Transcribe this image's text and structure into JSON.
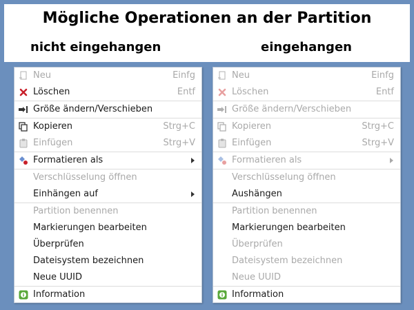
{
  "title": "Mögliche Operationen an der Partition",
  "subtitles": {
    "left": "nicht eingehangen",
    "right": "eingehangen"
  },
  "menus": [
    {
      "items": [
        {
          "label": "Neu",
          "shortcut": "Einfg",
          "enabled": false,
          "icon": "new-partition-icon"
        },
        {
          "label": "Löschen",
          "shortcut": "Entf",
          "enabled": true,
          "icon": "delete-icon"
        },
        {
          "label": "Größe ändern/Verschieben",
          "shortcut": "",
          "enabled": true,
          "icon": "resize-move-icon"
        },
        {
          "label": "Kopieren",
          "shortcut": "Strg+C",
          "enabled": true,
          "icon": "copy-icon"
        },
        {
          "label": "Einfügen",
          "shortcut": "Strg+V",
          "enabled": false,
          "icon": "paste-icon"
        },
        {
          "label": "Formatieren als",
          "shortcut": "",
          "enabled": true,
          "icon": "format-icon",
          "submenu": true
        },
        {
          "label": "Verschlüsselung öffnen",
          "shortcut": "",
          "enabled": false
        },
        {
          "label": "Einhängen auf",
          "shortcut": "",
          "enabled": true,
          "submenu": true
        },
        {
          "label": "Partition benennen",
          "shortcut": "",
          "enabled": false
        },
        {
          "label": "Markierungen bearbeiten",
          "shortcut": "",
          "enabled": true
        },
        {
          "label": "Überprüfen",
          "shortcut": "",
          "enabled": true
        },
        {
          "label": "Dateisystem bezeichnen",
          "shortcut": "",
          "enabled": true
        },
        {
          "label": "Neue UUID",
          "shortcut": "",
          "enabled": true
        },
        {
          "label": "Information",
          "shortcut": "",
          "enabled": true,
          "icon": "information-icon"
        }
      ]
    },
    {
      "items": [
        {
          "label": "Neu",
          "shortcut": "Einfg",
          "enabled": false,
          "icon": "new-partition-icon"
        },
        {
          "label": "Löschen",
          "shortcut": "Entf",
          "enabled": false,
          "icon": "delete-icon"
        },
        {
          "label": "Größe ändern/Verschieben",
          "shortcut": "",
          "enabled": false,
          "icon": "resize-move-icon"
        },
        {
          "label": "Kopieren",
          "shortcut": "Strg+C",
          "enabled": false,
          "icon": "copy-icon"
        },
        {
          "label": "Einfügen",
          "shortcut": "Strg+V",
          "enabled": false,
          "icon": "paste-icon"
        },
        {
          "label": "Formatieren als",
          "shortcut": "",
          "enabled": false,
          "icon": "format-icon",
          "submenu": true
        },
        {
          "label": "Verschlüsselung öffnen",
          "shortcut": "",
          "enabled": false
        },
        {
          "label": "Aushängen",
          "shortcut": "",
          "enabled": true
        },
        {
          "label": "Partition benennen",
          "shortcut": "",
          "enabled": false
        },
        {
          "label": "Markierungen bearbeiten",
          "shortcut": "",
          "enabled": true
        },
        {
          "label": "Überprüfen",
          "shortcut": "",
          "enabled": false
        },
        {
          "label": "Dateisystem bezeichnen",
          "shortcut": "",
          "enabled": false
        },
        {
          "label": "Neue UUID",
          "shortcut": "",
          "enabled": false
        },
        {
          "label": "Information",
          "shortcut": "",
          "enabled": true,
          "icon": "information-icon"
        }
      ]
    }
  ],
  "colors": {
    "background": "#6b8fbd",
    "disabled_text": "#a9a9a9",
    "delete_red": "#c8202a",
    "info_green": "#5aa83a"
  }
}
